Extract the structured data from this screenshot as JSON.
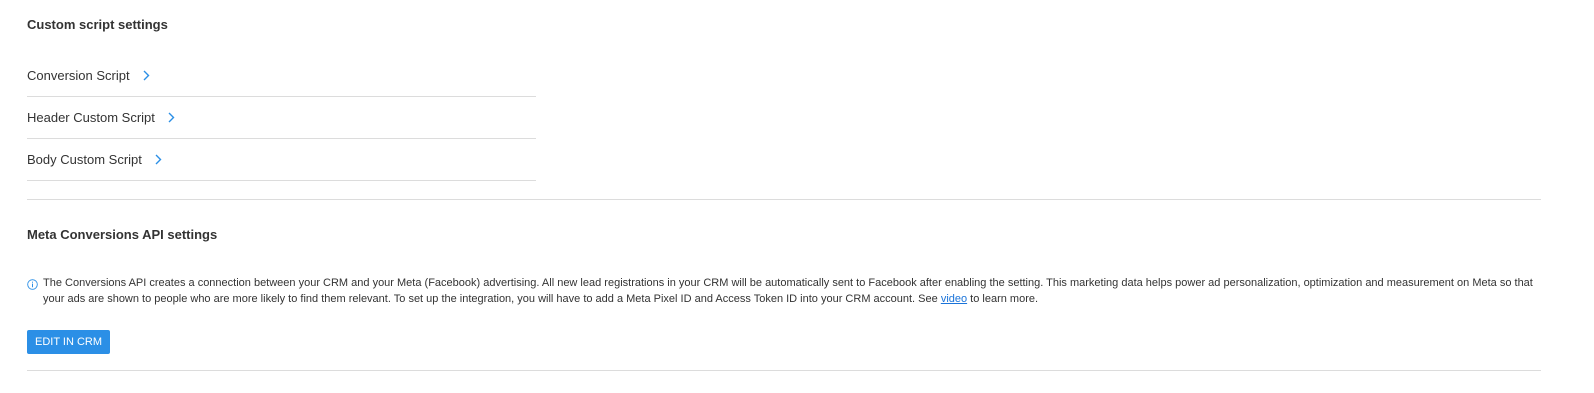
{
  "custom_scripts": {
    "title": "Custom script settings",
    "items": [
      {
        "label": "Conversion Script"
      },
      {
        "label": "Header Custom Script"
      },
      {
        "label": "Body Custom Script"
      }
    ],
    "chevron_icon": "chevron-right-icon",
    "chevron_color": "#2b8fe6"
  },
  "meta": {
    "title": "Meta Conversions API settings",
    "info_icon": "info-circle-icon",
    "info_text_before": "The Conversions API creates a connection between your CRM and your Meta (Facebook) advertising. All new lead registrations in your CRM will be automatically sent to Facebook after enabling the setting. This marketing data helps power ad personalization, optimization and measurement on Meta so that your ads are shown to people who are more likely to find them relevant. To set up the integration, you will have to add a Meta Pixel ID and Access Token ID into your CRM account. See ",
    "info_link": "video",
    "info_text_after": " to learn more.",
    "button_label": "EDIT IN CRM",
    "button_color": "#2b8fe6"
  }
}
